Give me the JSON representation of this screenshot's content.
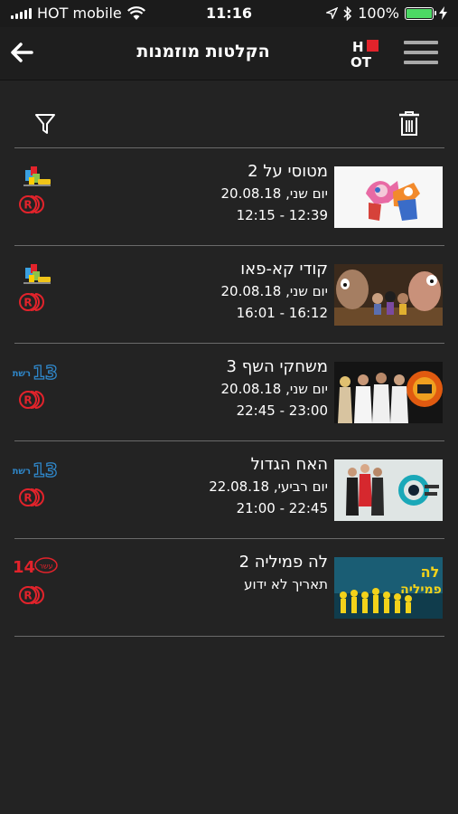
{
  "status_bar": {
    "carrier": "HOT mobile",
    "time": "11:16",
    "battery": "100%",
    "battery_level": 1.0
  },
  "header": {
    "title": "הקלטות מוזמנות",
    "logo_text_top": "H",
    "logo_text_bottom": "OT"
  },
  "toolbar": {
    "filter_icon": "filter-icon",
    "delete_icon": "trash-icon"
  },
  "recordings": [
    {
      "title": "מטוסי על 2",
      "date": "יום שני, 20.08.18",
      "time": "12:15 - 12:39",
      "channel": "kids-channel",
      "thumb": "super-wings"
    },
    {
      "title": "קודי קא-פאו",
      "date": "יום שני, 20.08.18",
      "time": "16:01 - 16:12",
      "channel": "kids-channel",
      "thumb": "cave-animation"
    },
    {
      "title": "משחקי השף 3",
      "date": "יום שני, 20.08.18",
      "time": "22:45 - 23:00",
      "channel": "reshet-13",
      "channel_text": "13",
      "channel_label": "רשת",
      "thumb": "chef-games"
    },
    {
      "title": "האח הגדול",
      "date": "יום רביעי, 22.08.18",
      "time": "21:00 - 22:45",
      "channel": "reshet-13",
      "channel_text": "13",
      "channel_label": "רשת",
      "thumb": "big-brother"
    },
    {
      "title": "לה פמיליה 2",
      "date": "תאריך לא ידוע",
      "time": "",
      "channel": "channel-14",
      "channel_text": "14",
      "channel_label": "עשר",
      "thumb": "la-familia",
      "thumb_text_1": "לה",
      "thumb_text_2": "פמיליה"
    }
  ],
  "colors": {
    "background": "#232323",
    "header": "#1e1e1e",
    "record_red": "#e2232b",
    "reshet_blue": "#2f86c8",
    "battery_green": "#4cd964"
  }
}
